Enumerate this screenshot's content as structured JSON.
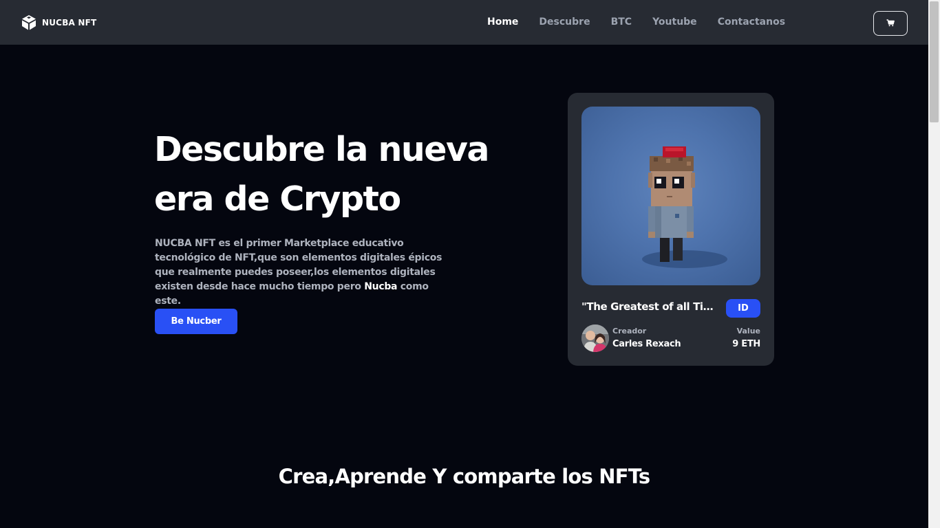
{
  "header": {
    "brand_name": "NUCBA NFT",
    "nav": [
      {
        "label": "Home",
        "active": true
      },
      {
        "label": "Descubre"
      },
      {
        "label": "BTC"
      },
      {
        "label": "Youtube"
      },
      {
        "label": "Contactanos"
      }
    ],
    "cart_icon": "cart-icon"
  },
  "hero": {
    "title_line1": "Descubre la nueva",
    "title_line2": "era de Crypto",
    "description_part1": "NUCBA NFT es el primer Marketplace educativo tecnológico de NFT,que son elementos digitales épicos que realmente puedes poseer,los elementos digitales existen desde hace mucho tiempo pero ",
    "description_bold": "Nucba",
    "description_part2": " como este.",
    "cta_label": "Be Nucber"
  },
  "card": {
    "title": "\"The Greatest of all Time\"",
    "badge": "ID",
    "creator_label": "Creador",
    "creator_name": "Carles Rexach",
    "value_label": "Value",
    "value_amount": "9 ETH"
  },
  "section": {
    "title": "Crea,Aprende Y comparte los NFTs"
  },
  "colors": {
    "background": "#04060f",
    "navbar": "#272b33",
    "accent": "#2950f5",
    "card": "#272b33"
  }
}
